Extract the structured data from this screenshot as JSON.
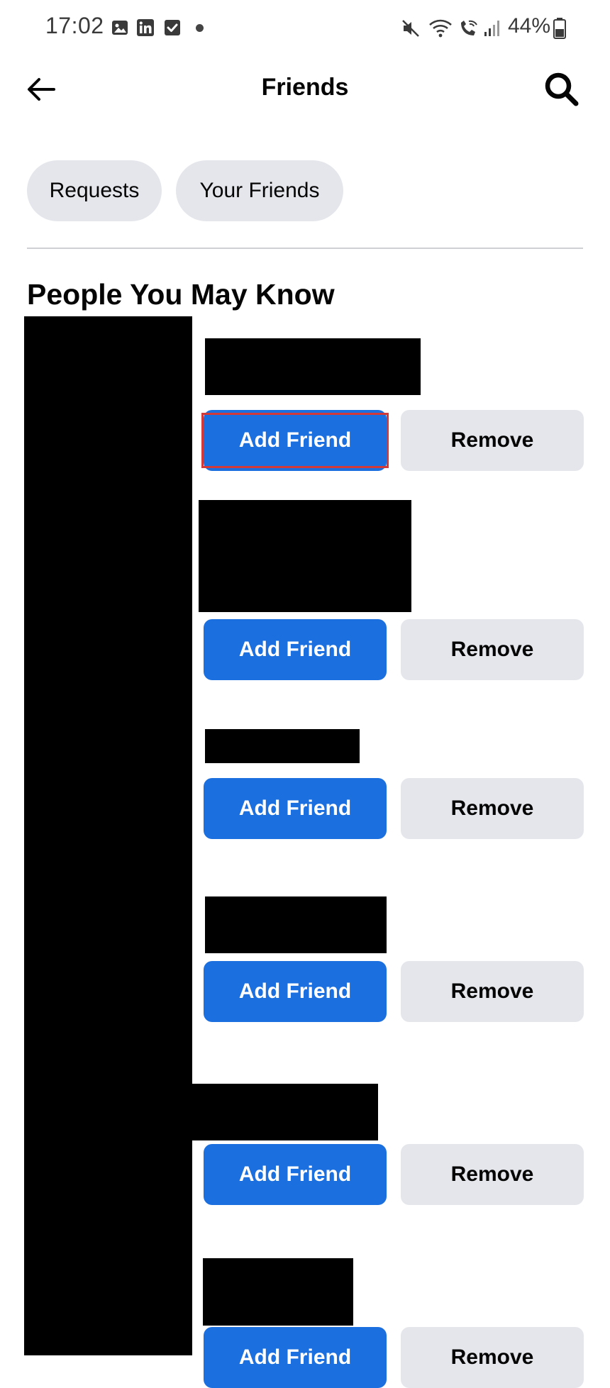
{
  "status_bar": {
    "time": "17:02",
    "battery": "44%",
    "left_icons": [
      "gallery-icon",
      "linkedin-icon",
      "checkbox-icon",
      "notification-dot"
    ],
    "right_icons": [
      "mute-icon",
      "wifi-icon",
      "wifi-call-icon",
      "signal-icon",
      "battery-icon"
    ]
  },
  "header": {
    "title": "Friends",
    "back_icon": "arrow-left-icon",
    "search_icon": "search-icon"
  },
  "chips": [
    {
      "label": "Requests"
    },
    {
      "label": "Your Friends"
    }
  ],
  "section": {
    "title": "People You May Know"
  },
  "suggestions": [
    {
      "add_label": "Add Friend",
      "remove_label": "Remove",
      "highlighted": true
    },
    {
      "add_label": "Add Friend",
      "remove_label": "Remove"
    },
    {
      "add_label": "Add Friend",
      "remove_label": "Remove"
    },
    {
      "add_label": "Add Friend",
      "remove_label": "Remove"
    },
    {
      "add_label": "Add Friend",
      "remove_label": "Remove"
    },
    {
      "add_label": "Add Friend",
      "remove_label": "Remove"
    }
  ],
  "colors": {
    "primary_button": "#1b6fdf",
    "secondary_button": "#e4e6eb",
    "highlight": "#d23a3a",
    "redaction": "#000000"
  }
}
